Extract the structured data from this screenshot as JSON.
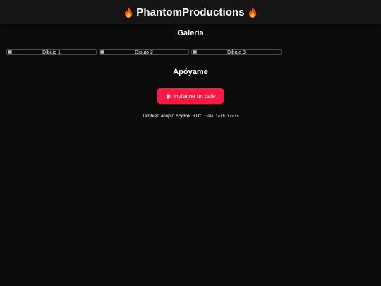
{
  "header": {
    "title": "PhantomProductions",
    "left_icon": "fire-icon",
    "right_icon": "fire-icon",
    "background": "#151515"
  },
  "gallery": {
    "title": "Galería",
    "items": [
      {
        "alt": "Dibujo 1",
        "icon": "broken-image-icon"
      },
      {
        "alt": "Dibujo 2",
        "icon": "broken-image-icon"
      },
      {
        "alt": "Dibujo 3",
        "icon": "broken-image-icon"
      }
    ]
  },
  "support": {
    "title": "Apóyame",
    "button": {
      "label": "Invítame un café",
      "icon": "coffee-icon",
      "color": "#ff1744"
    },
    "crypto": {
      "prefix": "También acepto",
      "emphasis": "crypto",
      "middle": ": BTC:",
      "wallet": "tuWalletBitcoin"
    }
  },
  "colors": {
    "page_background": "#0b0b0b",
    "text": "#ffffff",
    "accent": "#ff1744"
  }
}
